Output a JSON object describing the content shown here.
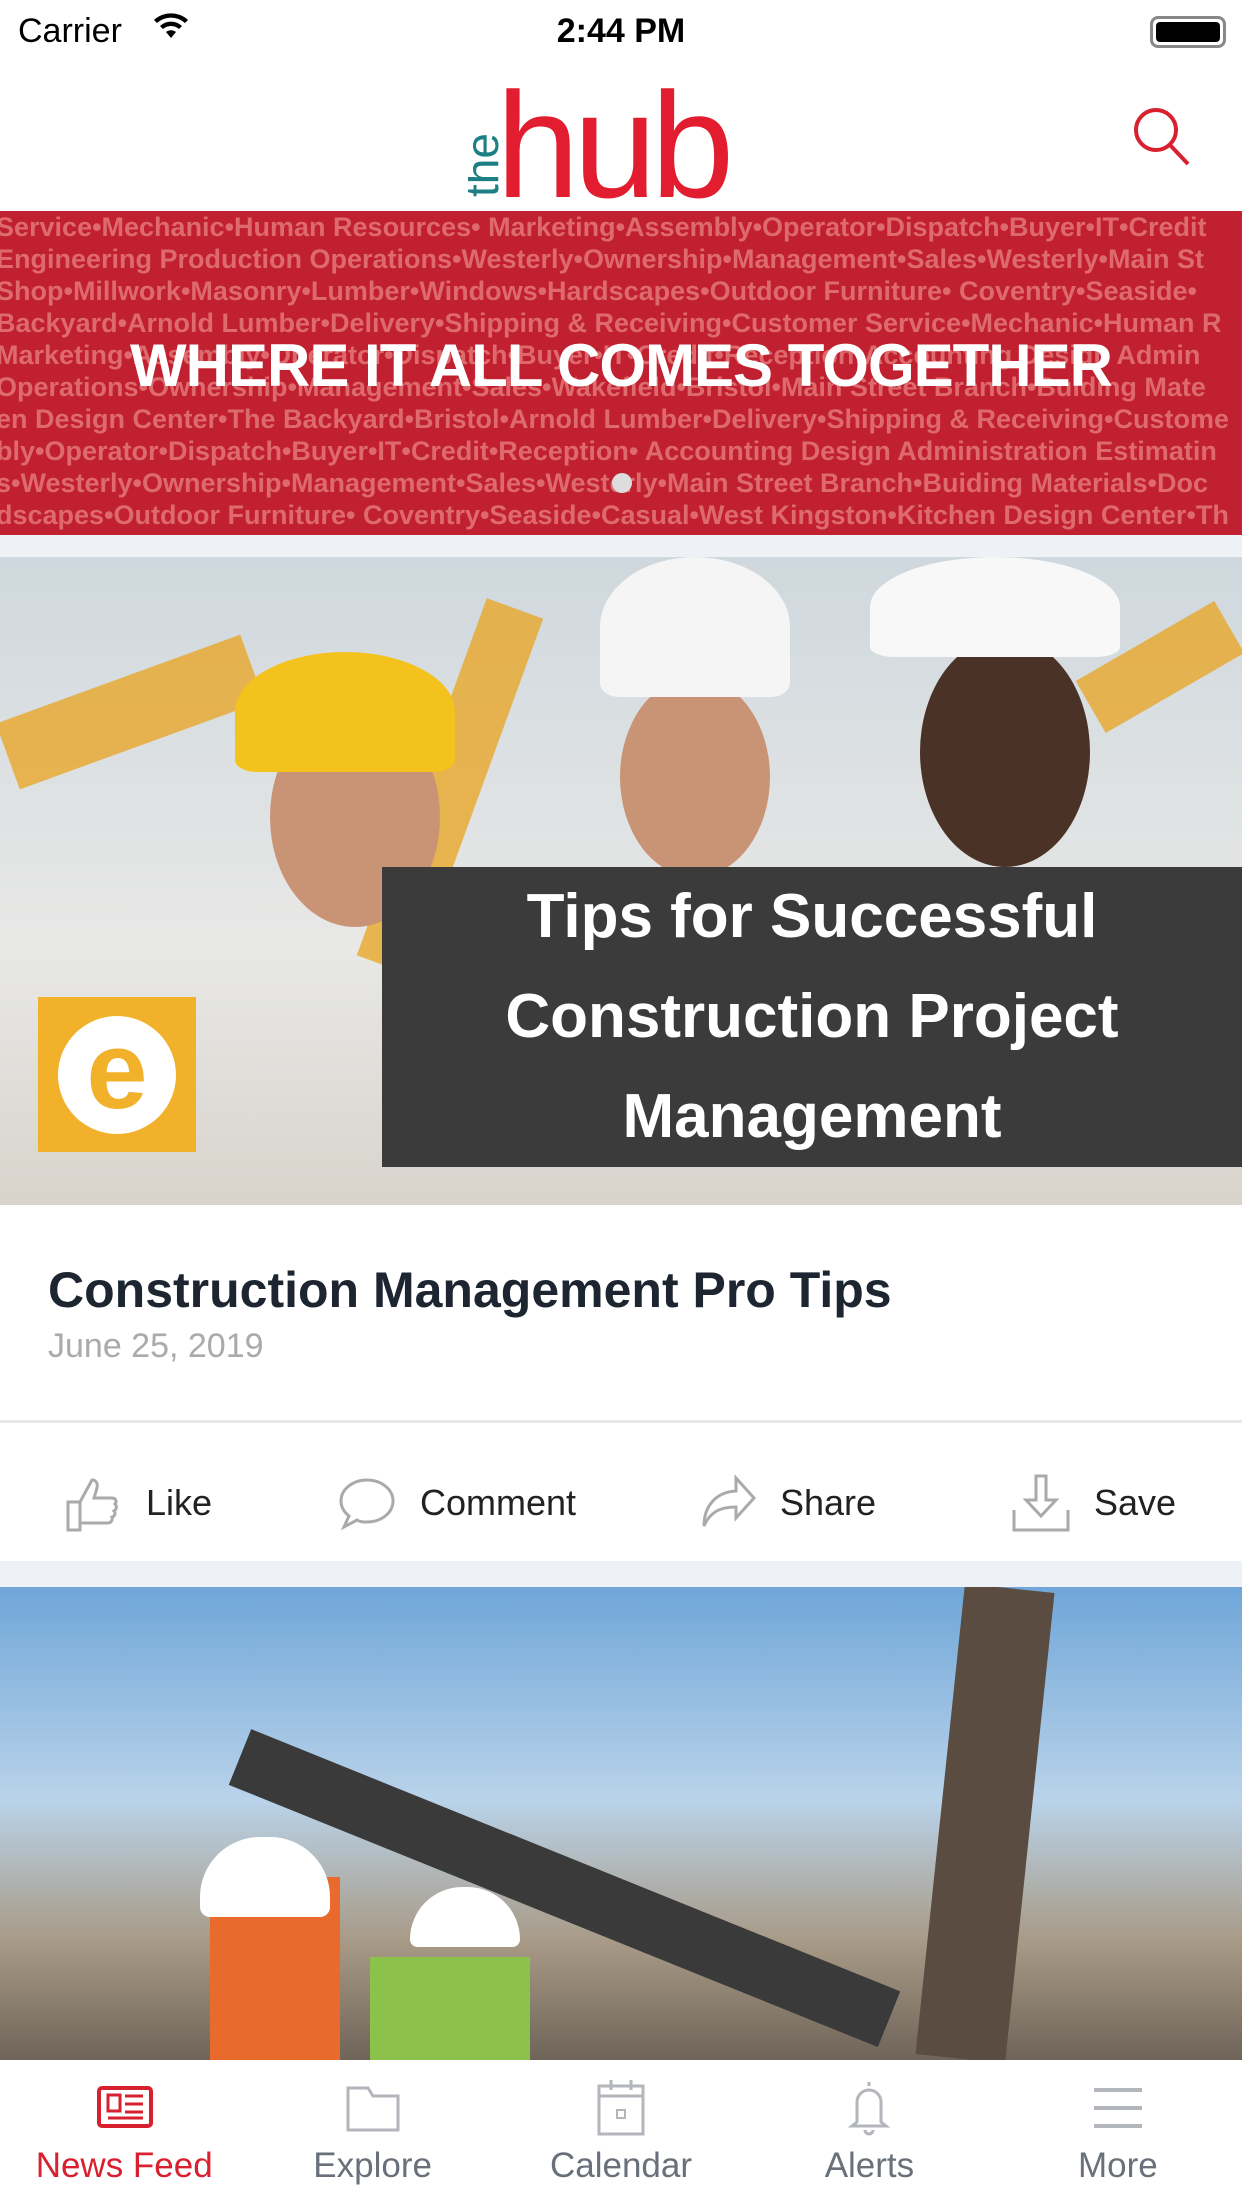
{
  "status_bar": {
    "carrier": "Carrier",
    "time": "2:44 PM"
  },
  "header": {
    "logo_text": "the hub",
    "search_icon": "search-icon"
  },
  "banner": {
    "tagline": "WHERE IT ALL COMES TOGETHER",
    "background_rows": [
      "Service•Mechanic•Human Resources• Marketing•Assembly•Operator•Dispatch•Buyer•IT•Credit",
      "Engineering Production Operations•Westerly•Ownership•Management•Sales•Westerly•Main St",
      "Shop•Millwork•Masonry•Lumber•Windows•Hardscapes•Outdoor Furniture• Coventry•Seaside•",
      "Backyard•Arnold Lumber•Delivery•Shipping & Receiving•Customer Service•Mechanic•Human R",
      "Marketing•Assembly•Operator•Dispatch•Buyer•IT•Credit•Reception•Accounting Design Admin",
      "Operations•Ownership•Management•Sales•Wakefield•Bristol•Main Street Branch•Buiding Mate",
      "en Design Center•The Backyard•Bristol•Arnold Lumber•Delivery•Shipping & Receiving•Custome",
      "bly•Operator•Dispatch•Buyer•IT•Credit•Reception• Accounting Design Administration Estimatin",
      "s•Westerly•Ownership•Management•Sales•Westerly•Main Street Branch•Buiding Materials•Doc",
      "dscapes•Outdoor Furniture• Coventry•Seaside•Casual•West Kingston•Kitchen Design Center•Th"
    ]
  },
  "post": {
    "image_caption": [
      "Tips for Successful",
      "Construction Project",
      "Management"
    ],
    "logo_letter": "e",
    "title": "Construction Management Pro Tips",
    "date": "June 25, 2019",
    "actions": [
      {
        "label": "Like",
        "icon": "thumbs-up-icon"
      },
      {
        "label": "Comment",
        "icon": "speech-bubble-icon"
      },
      {
        "label": "Share",
        "icon": "share-arrow-icon"
      },
      {
        "label": "Save",
        "icon": "download-tray-icon"
      }
    ]
  },
  "tabbar": {
    "items": [
      {
        "label": "News Feed",
        "icon": "newspaper-icon",
        "active": true
      },
      {
        "label": "Explore",
        "icon": "folder-icon"
      },
      {
        "label": "Calendar",
        "icon": "calendar-icon"
      },
      {
        "label": "Alerts",
        "icon": "bell-icon"
      },
      {
        "label": "More",
        "icon": "menu-icon"
      }
    ]
  },
  "colors": {
    "brand_red": "#d9202f",
    "banner_red": "#c0202f",
    "logo_teal": "#1b7f83",
    "inactive": "#6a707a"
  }
}
